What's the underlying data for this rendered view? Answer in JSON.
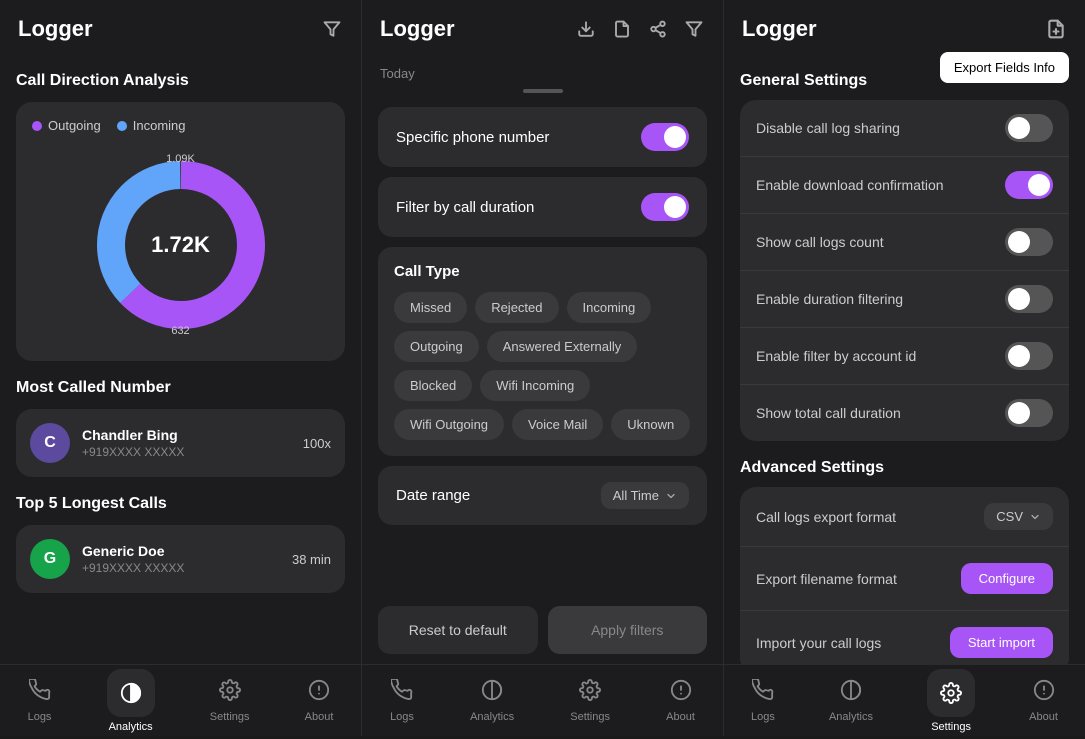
{
  "left": {
    "logo": "Logger",
    "filter_icon": "⊿",
    "section_chart": "Call Direction Analysis",
    "legend": {
      "outgoing": "Outgoing",
      "incoming": "Incoming"
    },
    "chart": {
      "center_value": "1.72K",
      "label_top": "1.09K",
      "label_bottom": "632",
      "outgoing_pct": 63,
      "incoming_pct": 37
    },
    "most_called_title": "Most Called Number",
    "most_called": {
      "initial": "C",
      "name": "Chandler Bing",
      "number": "+919XXXX XXXXX",
      "count": "100x"
    },
    "top5_title": "Top 5 Longest Calls",
    "top5": [
      {
        "initial": "G",
        "name": "Generic Doe",
        "number": "+919XXXX XXXXX",
        "duration": "38 min"
      }
    ],
    "nav": [
      {
        "icon": "📞",
        "label": "Logs",
        "active": false
      },
      {
        "icon": "◑",
        "label": "Analytics",
        "active": true
      },
      {
        "icon": "⚙",
        "label": "Settings",
        "active": false
      },
      {
        "icon": "ℹ",
        "label": "About",
        "active": false
      }
    ]
  },
  "mid": {
    "logo": "Logger",
    "date_label": "Today",
    "specific_phone": {
      "label": "Specific phone number",
      "enabled": true
    },
    "filter_duration": {
      "label": "Filter by call duration",
      "enabled": true
    },
    "call_type": {
      "title": "Call Type",
      "tags": [
        {
          "label": "Missed",
          "selected": false
        },
        {
          "label": "Rejected",
          "selected": false
        },
        {
          "label": "Incoming",
          "selected": false
        },
        {
          "label": "Outgoing",
          "selected": false
        },
        {
          "label": "Answered Externally",
          "selected": false
        },
        {
          "label": "Blocked",
          "selected": false
        },
        {
          "label": "Wifi Incoming",
          "selected": false
        },
        {
          "label": "Wifi Outgoing",
          "selected": false
        },
        {
          "label": "Voice Mail",
          "selected": false
        },
        {
          "label": "Uknown",
          "selected": false
        }
      ]
    },
    "date_range": {
      "label": "Date range",
      "value": "All Time"
    },
    "btn_reset": "Reset to default",
    "btn_apply": "Apply filters",
    "nav": [
      {
        "icon": "📞",
        "label": "Logs",
        "active": false
      },
      {
        "icon": "◑",
        "label": "Analytics",
        "active": false
      },
      {
        "icon": "⚙",
        "label": "Settings",
        "active": false
      },
      {
        "icon": "ℹ",
        "label": "About",
        "active": false
      }
    ]
  },
  "right": {
    "logo": "Logger",
    "export_tooltip": "Export Fields Info",
    "general_title": "General Settings",
    "general_settings": [
      {
        "label": "Disable call log sharing",
        "enabled": false
      },
      {
        "label": "Enable download confirmation",
        "enabled": true
      },
      {
        "label": "Show call logs count",
        "enabled": false
      },
      {
        "label": "Enable duration filtering",
        "enabled": false
      },
      {
        "label": "Enable filter by account id",
        "enabled": false
      },
      {
        "label": "Show total call duration",
        "enabled": false
      }
    ],
    "advanced_title": "Advanced Settings",
    "export_format": {
      "label": "Call logs export format",
      "value": "CSV"
    },
    "export_filename": {
      "label": "Export filename format",
      "btn": "Configure"
    },
    "import_logs": {
      "label": "Import your call logs",
      "btn": "Start import"
    },
    "nav": [
      {
        "icon": "📞",
        "label": "Logs",
        "active": false
      },
      {
        "icon": "◑",
        "label": "Analytics",
        "active": false
      },
      {
        "icon": "⚙",
        "label": "Settings",
        "active": true
      },
      {
        "icon": "ℹ",
        "label": "About",
        "active": false
      }
    ]
  }
}
